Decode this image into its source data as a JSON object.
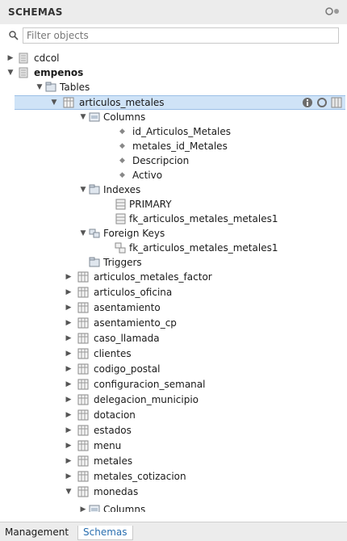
{
  "header": {
    "title": "SCHEMAS"
  },
  "filter": {
    "placeholder": "Filter objects"
  },
  "tree": {
    "schemas": [
      {
        "name": "cdcol"
      },
      {
        "name": "empenos"
      }
    ],
    "tables_label": "Tables",
    "selected_table": "articulos_metales",
    "columns_label": "Columns",
    "columns": [
      "id_Articulos_Metales",
      "metales_id_Metales",
      "Descripcion",
      "Activo"
    ],
    "indexes_label": "Indexes",
    "indexes": [
      "PRIMARY",
      "fk_articulos_metales_metales1"
    ],
    "foreign_keys_label": "Foreign Keys",
    "foreign_keys": [
      "fk_articulos_metales_metales1"
    ],
    "triggers_label": "Triggers",
    "other_tables": [
      "articulos_metales_factor",
      "articulos_oficina",
      "asentamiento",
      "asentamiento_cp",
      "caso_llamada",
      "clientes",
      "codigo_postal",
      "configuracion_semanal",
      "delegacion_municipio",
      "dotacion",
      "estados",
      "menu",
      "metales",
      "metales_cotizacion",
      "monedas"
    ],
    "monedas_columns_label": "Columns"
  },
  "footer": {
    "tabs": [
      "Management",
      "Schemas"
    ]
  },
  "colors": {
    "selection": "#cfe3f7",
    "active_tab": "#2a6fb0"
  }
}
